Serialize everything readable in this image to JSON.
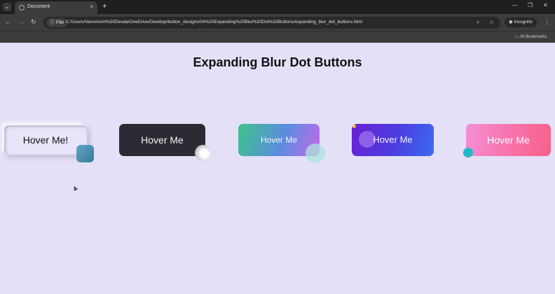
{
  "browser": {
    "tab_title": "Document",
    "tab_close": "×",
    "new_tab": "+",
    "file_chip": "File",
    "url": "C:/Users/Vanvirsinh%20Devda/OneDrive/Desktop/button_designs/04%20Expanding%20Blur%20Dot%20Buttons/expanding_blur_dot_buttons.html",
    "incognito": "Incognito",
    "all_bookmarks": "All Bookmarks"
  },
  "page": {
    "title": "Expanding Blur Dot Buttons",
    "buttons": [
      {
        "label": "Hover Me!"
      },
      {
        "label": "Hover Me"
      },
      {
        "label": "Hover Me"
      },
      {
        "label": "Hover Me"
      },
      {
        "label": "Hover Me"
      }
    ]
  }
}
